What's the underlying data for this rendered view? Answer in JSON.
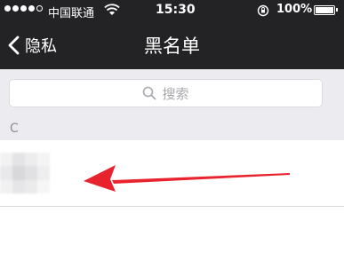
{
  "status_bar": {
    "carrier": "中国联通",
    "time": "15:30",
    "battery": "100%",
    "signal_icon": "signal-dots",
    "wifi_icon": "wifi-icon",
    "rotation_lock_icon": "rotation-lock-icon",
    "battery_icon": "battery-icon"
  },
  "nav": {
    "back_label": "隐私",
    "title": "黑名单",
    "back_icon": "chevron-left-icon"
  },
  "search": {
    "placeholder": "搜索",
    "icon": "search-icon"
  },
  "list": {
    "section_letter": "C",
    "items": [
      {
        "name": "",
        "avatar": "pixelated-avatar"
      }
    ]
  },
  "annotation": {
    "arrow_color": "#e8232d"
  },
  "colors": {
    "header_bg": "#232326",
    "search_bg": "#ececf0",
    "text_muted": "#8e8e93"
  }
}
